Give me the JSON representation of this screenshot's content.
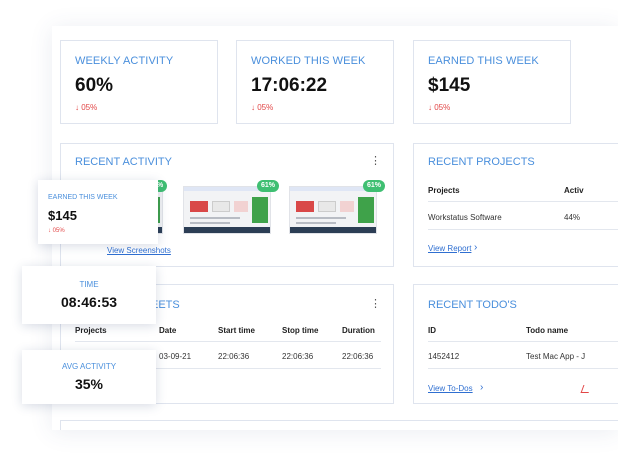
{
  "stats": [
    {
      "title": "WEEKLY ACTIVITY",
      "value": "60%",
      "delta": "↓ 05%"
    },
    {
      "title": "WORKED THIS WEEK",
      "value": "17:06:22",
      "delta": "↓ 05%"
    },
    {
      "title": "EARNED THIS WEEK",
      "value": "$145",
      "delta": "↓ 05%"
    }
  ],
  "recent_activity": {
    "title": "RECENT ACTIVITY",
    "menu_icon": "⋮",
    "screenshots": [
      {
        "percent": "%"
      },
      {
        "percent": "61%"
      },
      {
        "percent": "61%"
      }
    ],
    "link": "View Screenshots"
  },
  "recent_projects": {
    "title": "RECENT PROJECTS",
    "headers": [
      "Projects",
      "Activ"
    ],
    "rows": [
      {
        "project": "Workstatus Software",
        "activity": "44%"
      }
    ],
    "link": "View Report",
    "link_arrow": "›"
  },
  "timesheets": {
    "title": "EETS",
    "menu_icon": "⋮",
    "headers": [
      "Projects",
      "Date",
      "Start time",
      "Stop time",
      "Duration"
    ],
    "rows": [
      {
        "date": "03-09-21",
        "start": "22:06:36",
        "stop": "22:06:36",
        "duration": "22:06:36"
      }
    ]
  },
  "recent_todos": {
    "title": "RECENT TODO'S",
    "headers": [
      "ID",
      "Todo name"
    ],
    "rows": [
      {
        "id": "1452412",
        "name": "Test Mac App - J"
      }
    ],
    "link": "View To-Dos",
    "link_arrow": "›"
  },
  "float_earned": {
    "title": "EARNED THIS WEEK",
    "value": "$145",
    "delta": "↓ 05%"
  },
  "float_time": {
    "title": "TIME",
    "value": "08:46:53"
  },
  "float_activity": {
    "title": "AVG ACTIVITY",
    "value": "35%"
  },
  "colors": {
    "accent": "#4a8fdc",
    "negative": "#e24646",
    "badge": "#3fbf72"
  }
}
